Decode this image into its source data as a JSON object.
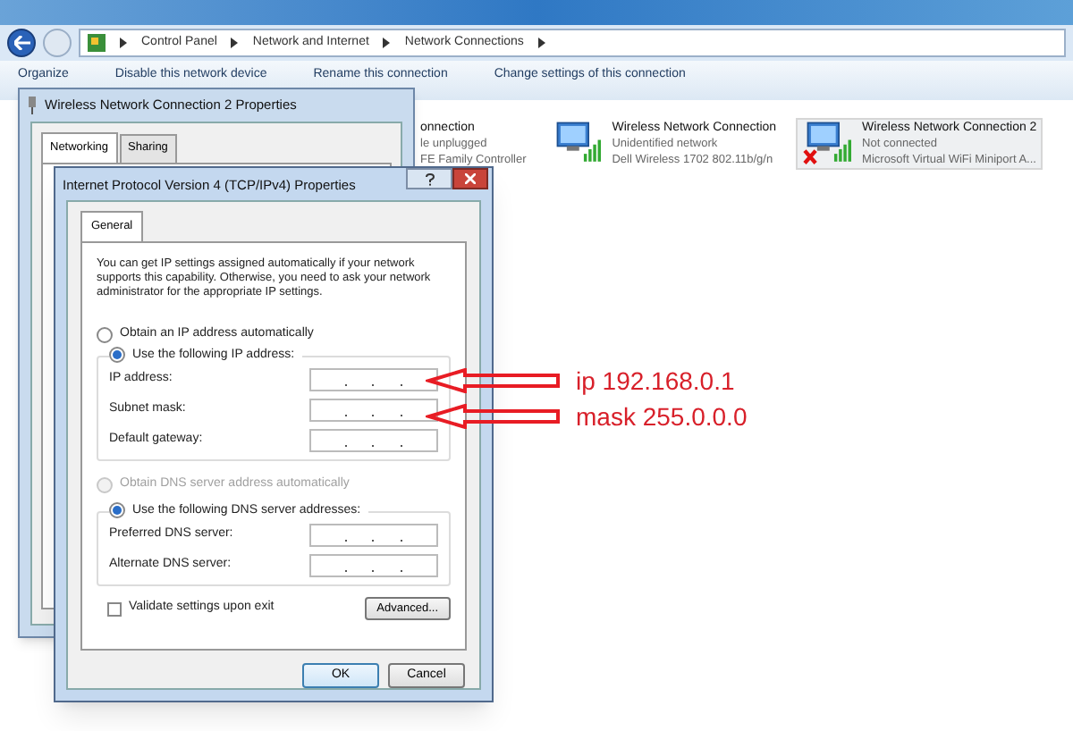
{
  "explorer": {
    "breadcrumbs": [
      "Control Panel",
      "Network and Internet",
      "Network Connections"
    ],
    "toolbar": [
      "Organize",
      "Disable this network device",
      "Rename this connection",
      "Change settings of this connection"
    ],
    "connections": [
      {
        "kind": "cut",
        "name": "onnection",
        "status": "le unplugged",
        "adapter": "FE Family Controller"
      },
      {
        "kind": "icon",
        "name": "Wireless Network Connection",
        "status": "Unidentified network",
        "adapter": "Dell Wireless 1702 802.11b/g/n",
        "disconnected": false,
        "selected": false
      },
      {
        "kind": "icon",
        "name": "Wireless Network Connection 2",
        "status": "Not connected",
        "adapter": "Microsoft Virtual WiFi Miniport A...",
        "disconnected": true,
        "selected": true
      }
    ]
  },
  "back_dialog": {
    "title": "Wireless Network Connection 2 Properties",
    "tabs": [
      {
        "label": "Networking",
        "selected": true
      },
      {
        "label": "Sharing",
        "selected": false
      }
    ]
  },
  "dialog": {
    "title": "Internet Protocol Version 4 (TCP/IPv4) Properties",
    "tabs": [
      {
        "label": "General",
        "selected": true
      }
    ],
    "intro": "You can get IP settings assigned automatically if your network supports this capability. Otherwise, you need to ask your network administrator for the appropriate IP settings.",
    "ip_options": [
      {
        "label": "Obtain an IP address automatically",
        "selected": false,
        "disabled": false
      },
      {
        "label": "Use the following IP address:",
        "selected": true,
        "disabled": false
      }
    ],
    "ip_fields": [
      {
        "label": "IP address:"
      },
      {
        "label": "Subnet mask:"
      },
      {
        "label": "Default gateway:"
      }
    ],
    "dns_options": [
      {
        "label": "Obtain DNS server address automatically",
        "selected": false,
        "disabled": true
      },
      {
        "label": "Use the following DNS server addresses:",
        "selected": true,
        "disabled": false
      }
    ],
    "dns_fields": [
      {
        "label": "Preferred DNS server:"
      },
      {
        "label": "Alternate DNS server:"
      }
    ],
    "validate": {
      "label": "Validate settings upon exit",
      "checked": false
    },
    "advanced_button": "Advanced...",
    "ok_button": "OK",
    "cancel_button": "Cancel"
  },
  "annotations": [
    {
      "text": "ip 192.168.0.1"
    },
    {
      "text": "mask 255.0.0.0"
    }
  ]
}
